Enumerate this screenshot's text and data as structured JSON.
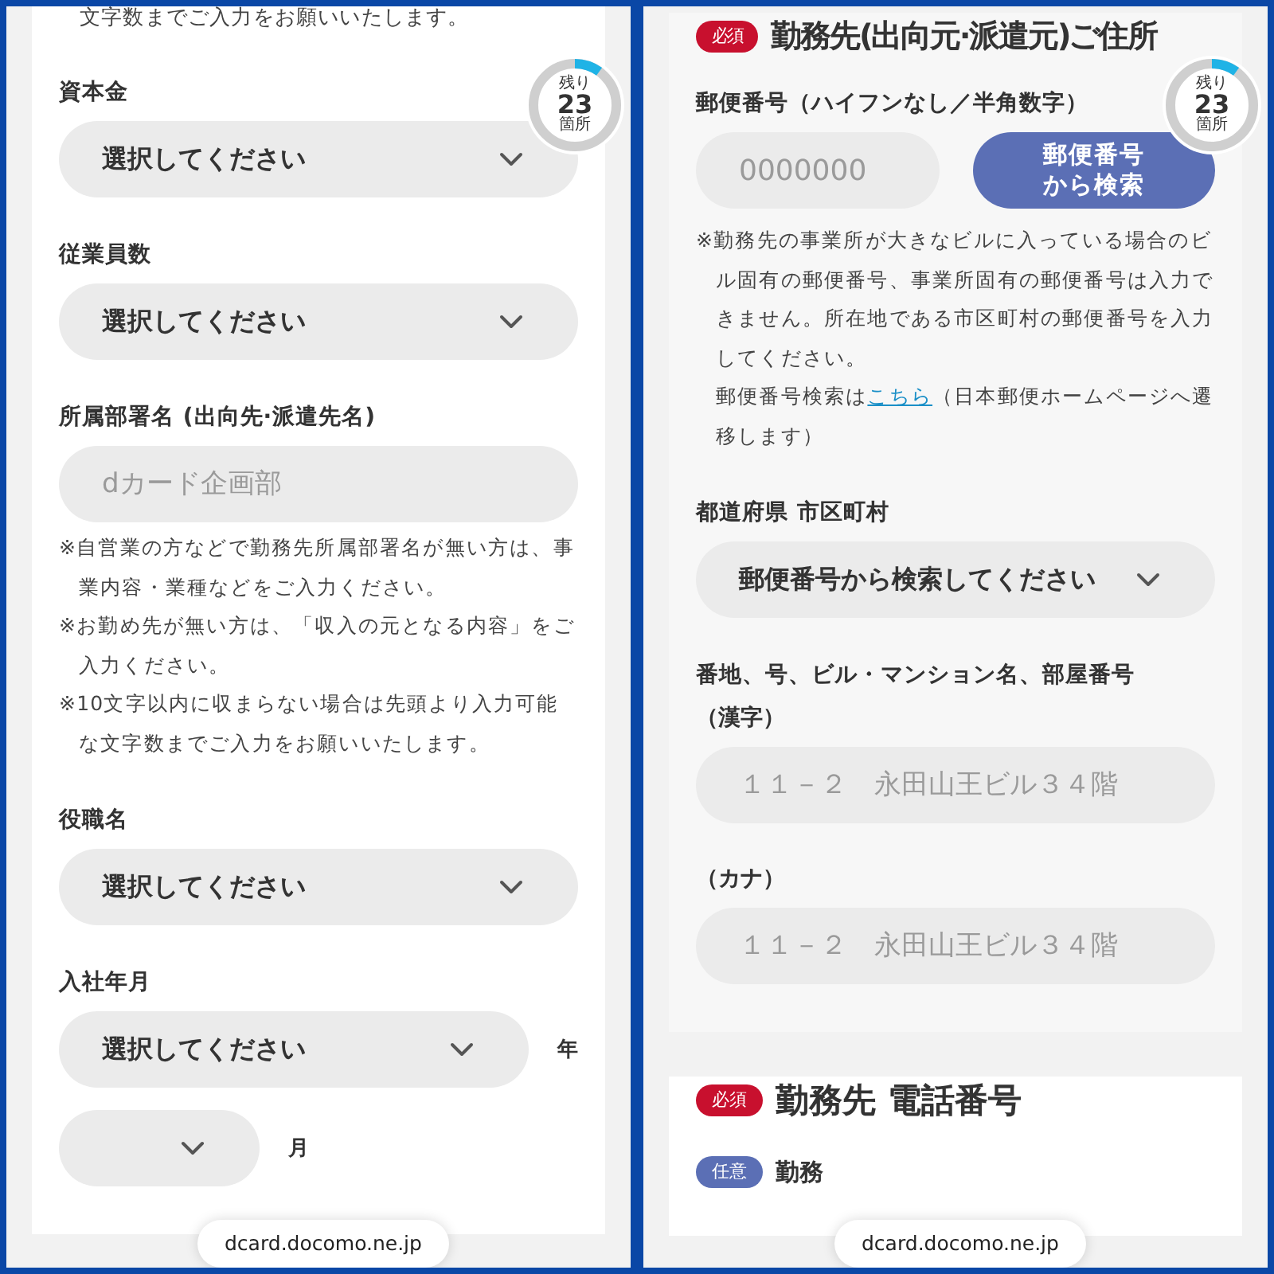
{
  "screens": [
    {
      "progress": {
        "top": "残り",
        "count": "23",
        "bottom": "箇所",
        "level": 0.1
      },
      "url": "dcard.docomo.ne.jp",
      "cards": [
        {
          "kind": "plain",
          "items": [
            {
              "kind": "cont",
              "text": "文字数までご入力をお願いいたします。"
            },
            {
              "kind": "label",
              "text": "資本金"
            },
            {
              "kind": "select",
              "value": "選択してください"
            },
            {
              "kind": "label",
              "text": "従業員数"
            },
            {
              "kind": "select",
              "value": "選択してください"
            },
            {
              "kind": "label",
              "text": "所属部署名 (出向先·派遣先名)"
            },
            {
              "kind": "input",
              "placeholder": "dカード企画部"
            },
            {
              "kind": "notes",
              "notes": [
                "※自営業の方などで勤務先所属部署名が無い方は、事業内容・業種などをご入力ください。",
                "※お勤め先が無い方は、「収入の元となる内容」をご入力ください。",
                "※10文字以内に収まらない場合は先頭より入力可能な文字数までご入力をお願いいたします。"
              ]
            },
            {
              "kind": "label",
              "text": "役職名"
            },
            {
              "kind": "select",
              "value": "選択してください"
            },
            {
              "kind": "label",
              "text": "入社年月"
            },
            {
              "kind": "select_unit",
              "value": "選択してください",
              "unit": "年"
            },
            {
              "kind": "select_unit",
              "unit": "月"
            }
          ]
        }
      ]
    },
    {
      "progress": {
        "top": "残り",
        "count": "23",
        "bottom": "箇所",
        "level": 0.1
      },
      "url": "dcard.docomo.ne.jp",
      "cards": [
        {
          "kind": "panel",
          "items": [
            {
              "kind": "title",
              "badge": {
                "text": "必須",
                "color": "#c8102e"
              },
              "text": "勤務先(出向元·派遣元)ご住所"
            },
            {
              "kind": "label",
              "text": "郵便番号（ハイフンなし／半角数字）"
            },
            {
              "kind": "zip",
              "placeholder": "0000000",
              "button": "郵便番号から検索"
            },
            {
              "kind": "notes",
              "notes": [
                "※勤務先の事業所が大きなビルに入っている場合のビル固有の郵便番号、事業所固有の郵便番号は入力できません。所在地である市区町村の郵便番号を入力してください。"
              ],
              "link_note": {
                "before": "郵便番号検索は",
                "link": "こちら",
                "after": "（日本郵便ホームページへ遷移します）"
              }
            },
            {
              "kind": "label",
              "text": "都道府県 市区町村"
            },
            {
              "kind": "select",
              "value": "郵便番号から検索してください"
            },
            {
              "kind": "label",
              "text": "番地、号、ビル・マンション名、部屋番号"
            },
            {
              "kind": "sublabel",
              "text": "（漢字）"
            },
            {
              "kind": "input",
              "placeholder": "１１－２　永田山王ビル３４階"
            },
            {
              "kind": "sublabel",
              "text": "（カナ）"
            },
            {
              "kind": "input",
              "placeholder": "１１－２　永田山王ビル３４階"
            }
          ]
        },
        {
          "kind": "plain",
          "items": [
            {
              "kind": "title",
              "badge": {
                "text": "必須",
                "color": "#c8102e"
              },
              "text": "勤務先 電話番号"
            },
            {
              "kind": "badge_label",
              "badge": {
                "text": "任意",
                "color": "#5b6fb5"
              },
              "text": "勤務"
            }
          ]
        }
      ]
    }
  ]
}
